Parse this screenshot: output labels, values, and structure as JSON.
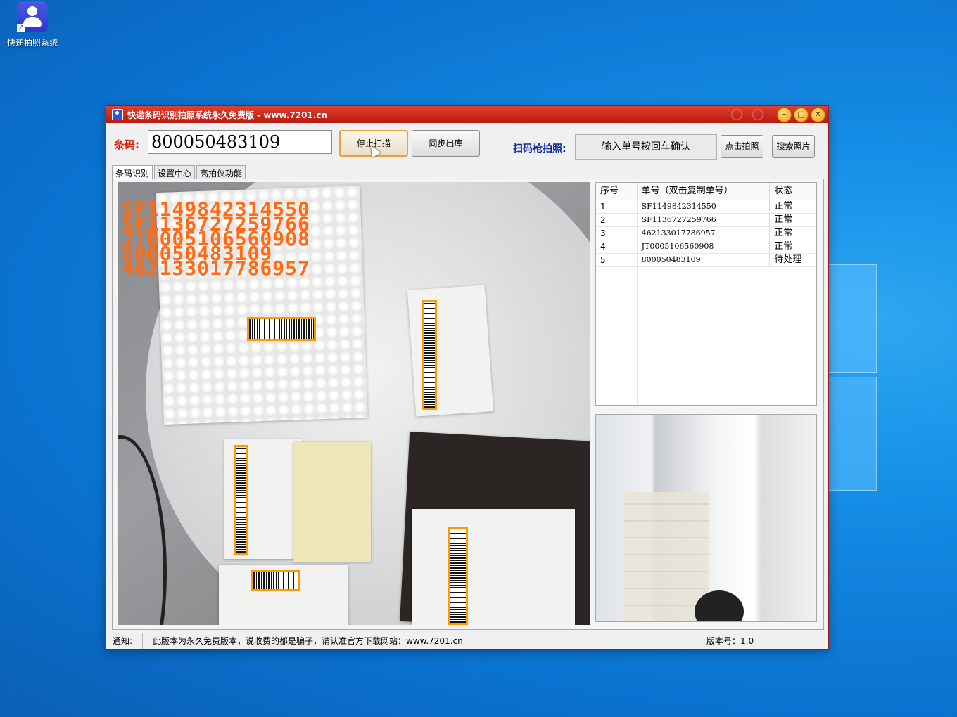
{
  "desktop": {
    "icon_label": "快递拍照系统"
  },
  "window": {
    "title": "快递条码识别拍照系统永久免费版  -  www.7201.cn",
    "minimize_label": "–",
    "maximize_label": "□",
    "close_label": "✕"
  },
  "toolbar": {
    "code_label": "条码:",
    "code_value": "800050483109",
    "stop_scan_label": "停止扫描",
    "sync_out_label": "同步出库",
    "scanner_label": "扫码枪拍照:",
    "scanner_input_text": "输入单号按回车确认",
    "click_photo_label": "点击拍照",
    "search_photo_label": "搜索照片"
  },
  "tabs": [
    {
      "label": "条码识别"
    },
    {
      "label": "设置中心"
    },
    {
      "label": "高拍仪功能"
    }
  ],
  "overlay_codes": [
    "SF1149842314550",
    "SF1136727259766",
    "JT0005106560908",
    "800050483109",
    "462133017786957"
  ],
  "table": {
    "headers": [
      "序号",
      "单号（双击复制单号）",
      "状态"
    ],
    "rows": [
      {
        "no": "1",
        "code": "SF1149842314550",
        "status": "正常"
      },
      {
        "no": "2",
        "code": "SF1136727259766",
        "status": "正常"
      },
      {
        "no": "3",
        "code": "462133017786957",
        "status": "正常"
      },
      {
        "no": "4",
        "code": "JT0005106560908",
        "status": "正常"
      },
      {
        "no": "5",
        "code": "800050483109",
        "status": "待处理"
      }
    ]
  },
  "status_bar": {
    "notice_label": "通知:",
    "notice_text": "此版本为永久免费版本，说收费的都是骗子，请认准官方下载网站：www.7201.cn",
    "version_text": "版本号：1.0"
  },
  "colors": {
    "titlebar": "#c8241a",
    "code_label": "#d8200e",
    "scanner_label": "#102a9a",
    "overlay_text": "#ff6a12",
    "barcode_frame": "#ff9a00"
  }
}
